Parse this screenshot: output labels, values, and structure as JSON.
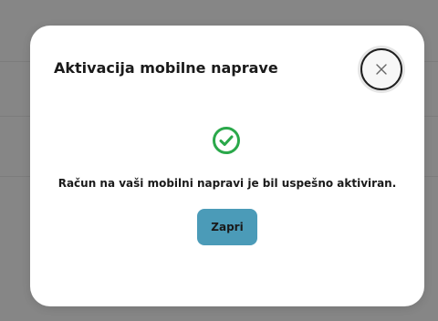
{
  "modal": {
    "title": "Aktivacija mobilne naprave",
    "message": "Račun na vaši mobilni napravi je bil uspešno aktiviran.",
    "close_button_label": "Zapri",
    "close_icon": "close-icon",
    "status_icon": "check-circle-icon"
  },
  "colors": {
    "overlay": "#868686",
    "success": "#2aa84a",
    "button": "#4b9bb8"
  }
}
